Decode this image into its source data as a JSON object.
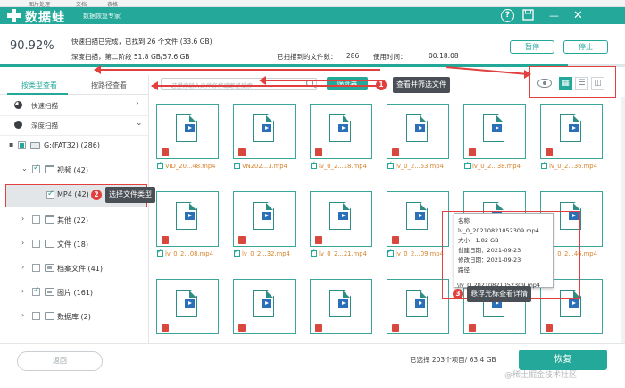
{
  "colors": {
    "accent": "#23a89a",
    "annotation": "#e23f3f",
    "file_name": "#d8832b"
  },
  "top_strip": {
    "items": [
      "图片处理",
      "文档",
      "表格"
    ]
  },
  "titlebar": {
    "app_name": "数据蛙",
    "subtitle": "数据恢复专家",
    "help_icon": "?",
    "save_icon": "floppy-icon",
    "minimize_icon": "—",
    "close_icon": "✕"
  },
  "header": {
    "percent": "90.92%",
    "line1": "快速扫描已完成，已找到 26 个文件 (33.6 GB)",
    "line2": "深度扫描，第二阶段 51.8 GB/57.6 GB",
    "found_label": "已扫描到的文件数：",
    "found_count": "286",
    "time_label": "使用时间：",
    "time_value": "00:18:08",
    "pause_label": "暂停",
    "stop_label": "停止",
    "progress": 0.9092
  },
  "sidebar": {
    "tab_type": "按类型查看",
    "tab_path": "按路径查看",
    "quick_scan": "快速扫描",
    "deep_scan": "深度扫描",
    "tree": [
      {
        "label": "G:(FAT32) (286)"
      },
      {
        "label": "视频 (42)"
      },
      {
        "label": "MP4 (42)"
      },
      {
        "label": "其他 (22)"
      },
      {
        "label": "文件 (18)"
      },
      {
        "label": "档案文件 (41)"
      },
      {
        "label": "图片 (161)"
      },
      {
        "label": "数据库 (2)"
      }
    ]
  },
  "toolbar": {
    "search_placeholder": "这里你输入文件名称或路径搜索",
    "filter_label": "筛选器",
    "view_buttons": [
      "grid-view-icon",
      "list-view-icon",
      "detail-view-icon"
    ]
  },
  "files": [
    "VID_20...48.mp4",
    "VN202...1.mp4",
    "lv_0_2...18.mp4",
    "lv_0_2...53.mp4",
    "lv_0_2...38.mp4",
    "lv_0_2...36.mp4",
    "lv_0_2...08.mp4",
    "lv_0_2...32.mp4",
    "lv_0_2...21.mp4",
    "lv_0_2...09.mp4",
    "",
    "lv_0_2...46.mp4"
  ],
  "tooltip": {
    "name_label": "名称：",
    "name": "lv_0_20210821052309.mp4",
    "size_label": "大小：",
    "size": "1.82 GB",
    "created_label": "创建日期：",
    "created": "2021-09-23",
    "modified_label": "修改日期：",
    "modified": "2021-09-23",
    "path_label": "路径：",
    "path": "\\lv_0_20210821052309.mp4"
  },
  "annotations": {
    "step1_num": "1",
    "step1_text": "查看并筛选文件",
    "step2_num": "2",
    "step2_text": "选择文件类型",
    "step3_num": "3",
    "step3_text": "悬浮光标查看详情"
  },
  "bottom": {
    "back_label": "返回",
    "selected_text": "已选择 203个项目/ 63.4 GB",
    "recover_label": "恢复",
    "watermark": "@稀土掘金技术社区"
  }
}
